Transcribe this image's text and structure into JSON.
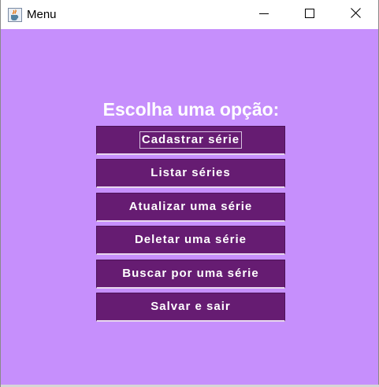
{
  "window": {
    "title": "Menu",
    "app_icon": "java-cup-icon",
    "controls": {
      "minimize_icon": "minimize-icon",
      "maximize_icon": "maximize-icon",
      "close_icon": "close-icon"
    }
  },
  "colors": {
    "background": "#c68ffc",
    "button": "#661c72",
    "text": "#ffffff"
  },
  "menu": {
    "heading": "Escolha uma opção:",
    "buttons": [
      {
        "label": "Cadastrar série",
        "focused": true
      },
      {
        "label": "Listar séries",
        "focused": false
      },
      {
        "label": "Atualizar uma série",
        "focused": false
      },
      {
        "label": "Deletar uma série",
        "focused": false
      },
      {
        "label": "Buscar por uma série",
        "focused": false
      },
      {
        "label": "Salvar e sair",
        "focused": false
      }
    ]
  }
}
